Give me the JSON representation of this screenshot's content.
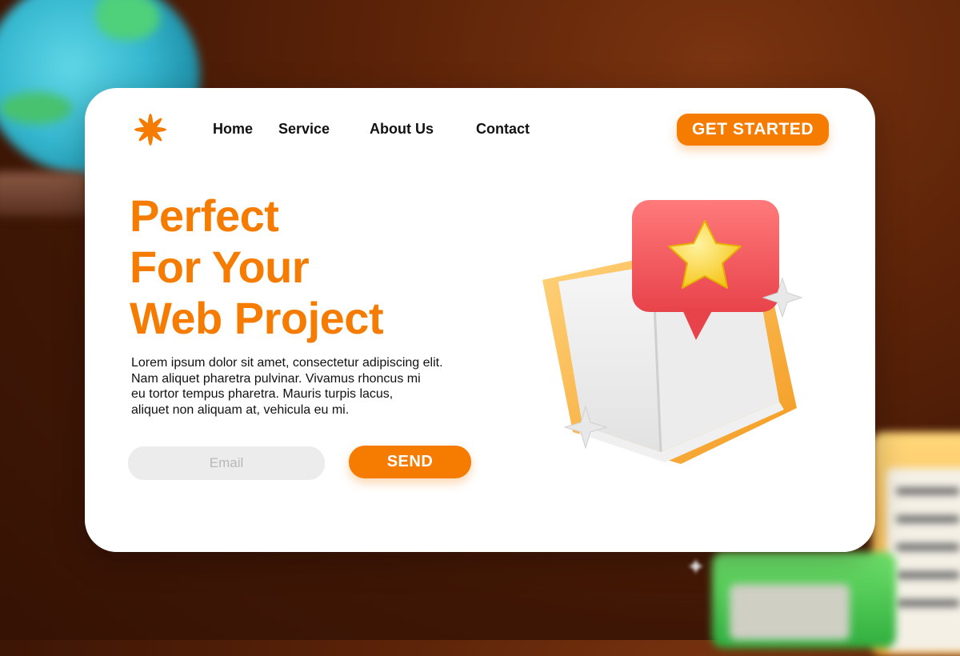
{
  "nav": {
    "items": [
      {
        "label": "Home"
      },
      {
        "label": "Service"
      },
      {
        "label": "About Us"
      },
      {
        "label": "Contact"
      }
    ],
    "cta_label": "GET STARTED"
  },
  "logo": {
    "icon": "asterisk-logo-icon",
    "color": "#f57c00"
  },
  "hero": {
    "headline_lines": [
      "Perfect",
      "For Your",
      "Web Project"
    ],
    "description_lines": [
      "Lorem ipsum dolor sit amet, consectetur adipiscing elit.",
      "Nam aliquet pharetra pulvinar. Vivamus rhoncus mi",
      "eu tortor tempus pharetra. Mauris turpis lacus,",
      "aliquet non aliquam at, vehicula eu mi."
    ]
  },
  "form": {
    "email_placeholder": "Email",
    "email_value": "",
    "send_label": "SEND"
  },
  "illustration": {
    "icon": "open-book-with-star-badge-icon"
  },
  "colors": {
    "accent": "#f57c00",
    "card": "#ffffff",
    "background": "#4a1b06"
  }
}
